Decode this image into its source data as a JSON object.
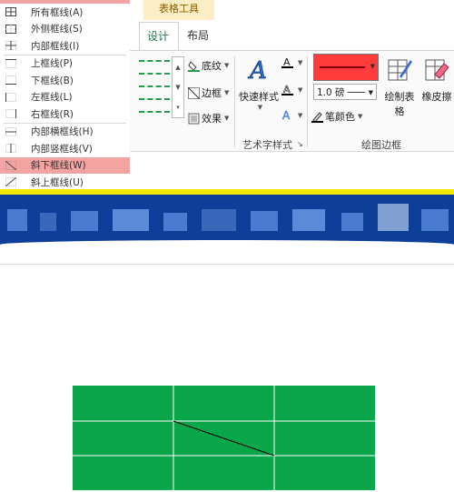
{
  "menu": {
    "items": [
      {
        "label": "所有框线(A)",
        "icon": "all-borders-icon",
        "highlight": false
      },
      {
        "label": "外侧框线(S)",
        "icon": "outside-borders-icon",
        "highlight": false
      },
      {
        "label": "内部框线(I)",
        "icon": "inside-borders-icon",
        "highlight": false
      },
      {
        "label": "上框线(P)",
        "icon": "top-border-icon",
        "highlight": false
      },
      {
        "label": "下框线(B)",
        "icon": "bottom-border-icon",
        "highlight": false
      },
      {
        "label": "左框线(L)",
        "icon": "left-border-icon",
        "highlight": false
      },
      {
        "label": "右框线(R)",
        "icon": "right-border-icon",
        "highlight": false
      },
      {
        "label": "内部横框线(H)",
        "icon": "inside-horizontal-border-icon",
        "highlight": false
      },
      {
        "label": "内部竖框线(V)",
        "icon": "inside-vertical-border-icon",
        "highlight": false
      },
      {
        "label": "斜下框线(W)",
        "icon": "diagonal-down-border-icon",
        "highlight": true
      },
      {
        "label": "斜上框线(U)",
        "icon": "diagonal-up-border-icon",
        "highlight": false
      }
    ]
  },
  "ribbon": {
    "context_header": "表格工具",
    "tabs": [
      "设计",
      "布局"
    ],
    "shading_label": "底纹",
    "borders_label": "边框",
    "effects_label": "效果",
    "quick_styles_label": "快速样式",
    "wordart_group_label": "艺术字样式",
    "pen_weight": "1.0 磅",
    "pen_color_label": "笔颜色",
    "draw_table_label": "绘制表格",
    "eraser_label": "橡皮擦",
    "draw_borders_group_label": "绘图边框",
    "colors": {
      "pen_color": "#ff3b3b",
      "shading_color": "#1ea14a",
      "accent": "#217346"
    }
  },
  "table": {
    "rows": 3,
    "cols": 3,
    "fill": "#0aa64a",
    "grid_color": "#ffffff",
    "diagonal_color": "#000000"
  }
}
